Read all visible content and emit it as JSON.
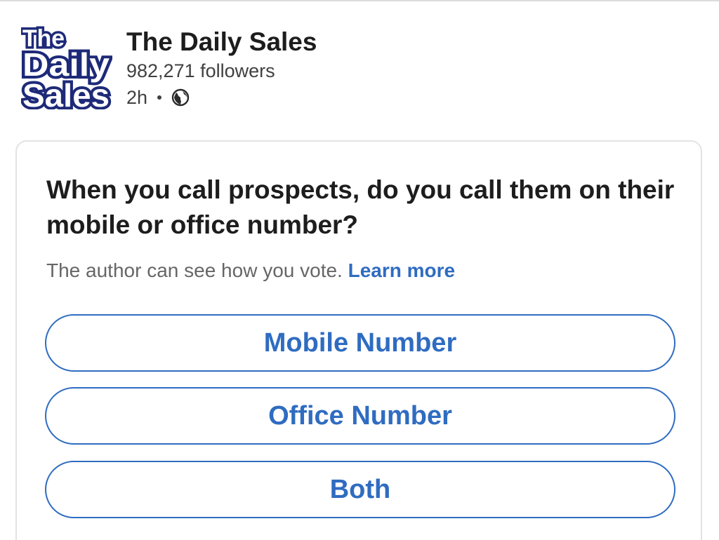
{
  "post": {
    "company_name": "The Daily Sales",
    "followers": "982,271 followers",
    "time_ago": "2h",
    "logo_text": [
      "The",
      "Daily",
      "Sales"
    ],
    "visibility_icon": "globe-icon"
  },
  "poll": {
    "question": "When you call prospects, do you call them on their mobile or office number?",
    "author_note": "The author can see how you vote.",
    "learn_more": "Learn more",
    "options": [
      {
        "label": "Mobile Number"
      },
      {
        "label": "Office Number"
      },
      {
        "label": "Both"
      }
    ]
  },
  "colors": {
    "accent": "#2f6cc1",
    "logo_navy": "#1e2a78",
    "text_primary": "#1d1d1d",
    "text_secondary": "#666666"
  }
}
